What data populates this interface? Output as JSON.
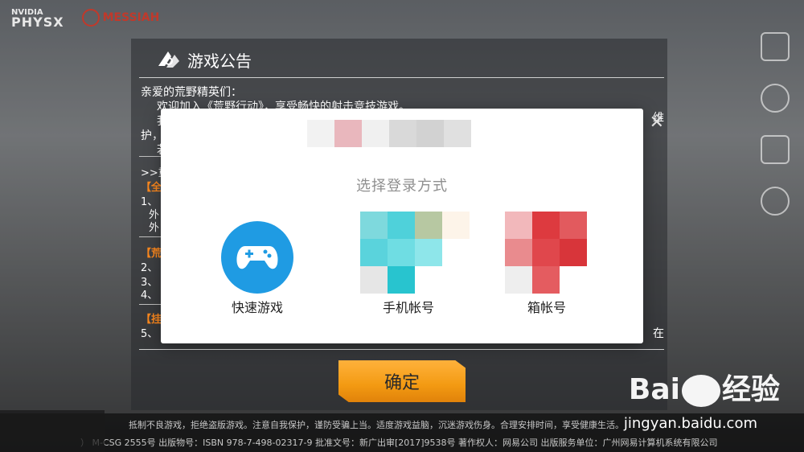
{
  "top_logos": {
    "nvidia": "NVIDIA",
    "physx": "PHYSX",
    "messiah": "MESSIAH"
  },
  "notice": {
    "title": "游戏公告",
    "greeting": "亲爱的荒野精英们：",
    "line1": "欢迎加入《荒野行动》，享受畅快的射击竞技游戏。",
    "line2_start": "我",
    "line2_end": "维",
    "line3_start": "护，",
    "line4_start": "若",
    "section_important": ">>重",
    "tag1": "【全",
    "item1": "1、",
    "item1a": "外",
    "item1b": "外",
    "tag2": "【荒",
    "item2": "2、",
    "item3": "3、",
    "item4": "4、",
    "tag3": "【挂",
    "item5": "5、",
    "item5_end": "在",
    "close_symbol": "✕"
  },
  "confirm_label": "确定",
  "dialog": {
    "subtitle": "选择登录方式",
    "options": [
      {
        "label": "快速游戏",
        "icon": "gamepad-icon"
      },
      {
        "label": "手机帐号",
        "icon": "phone-icon"
      },
      {
        "label": "箱帐号",
        "icon": "mail-icon"
      }
    ]
  },
  "side_icons": [
    "account-icon",
    "language-icon",
    "settings-icon",
    "service-icon"
  ],
  "watermark": {
    "text_left": "Bai",
    "text_right": "经验",
    "url": "jingyan.baidu.com"
  },
  "footer": {
    "line1": "抵制不良游戏，拒绝盗版游戏。注意自我保护，谨防受骗上当。适度游戏益脑，沉迷游戏伤身。合理安排时间，享受健康生活。",
    "line2": "） M-CSG 2555号   出版物号：ISBN 978-7-498-02317-9   批准文号：新广出审[2017]9538号   著作权人：网易公司   出版服务单位：广州网易计算机系统有限公司"
  },
  "colors": {
    "accent_orange": "#f39a12",
    "quick_blue": "#1f9be3",
    "section_orange": "#ff8a1e"
  }
}
